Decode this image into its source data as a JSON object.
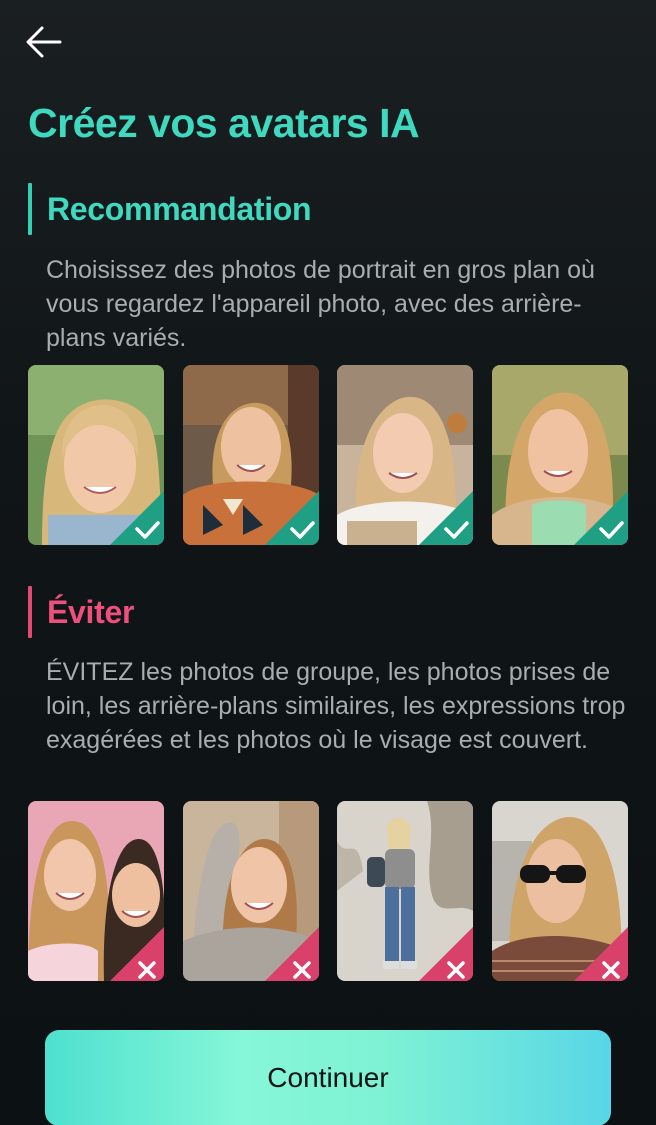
{
  "header": {
    "back_icon": "arrow-left-icon",
    "title": "Créez vos avatars IA"
  },
  "recommend": {
    "title": "Recommandation",
    "accent": "#36cdb7",
    "description": "Choisissez des photos de portrait en gros plan où vous regardez l'appareil photo, avec des arrière-plans variés.",
    "photos": [
      {
        "name": "close-up smiling portrait",
        "badge": "check-icon"
      },
      {
        "name": "smiling portrait outdoor",
        "badge": "check-icon"
      },
      {
        "name": "smiling portrait indoor",
        "badge": "check-icon"
      },
      {
        "name": "smiling portrait in park",
        "badge": "check-icon"
      }
    ]
  },
  "avoid": {
    "title": "Éviter",
    "accent": "#e24a70",
    "description": "ÉVITEZ les photos de groupe, les photos prises de loin, les arrière-plans similaires, les expressions trop exagérées et les photos où le visage est couvert.",
    "photos": [
      {
        "name": "group photo",
        "badge": "cross-icon"
      },
      {
        "name": "exaggerated expression",
        "badge": "cross-icon"
      },
      {
        "name": "photo taken from far",
        "badge": "cross-icon"
      },
      {
        "name": "face covered by sunglasses",
        "badge": "cross-icon"
      }
    ]
  },
  "footer": {
    "continue_label": "Continuer"
  }
}
